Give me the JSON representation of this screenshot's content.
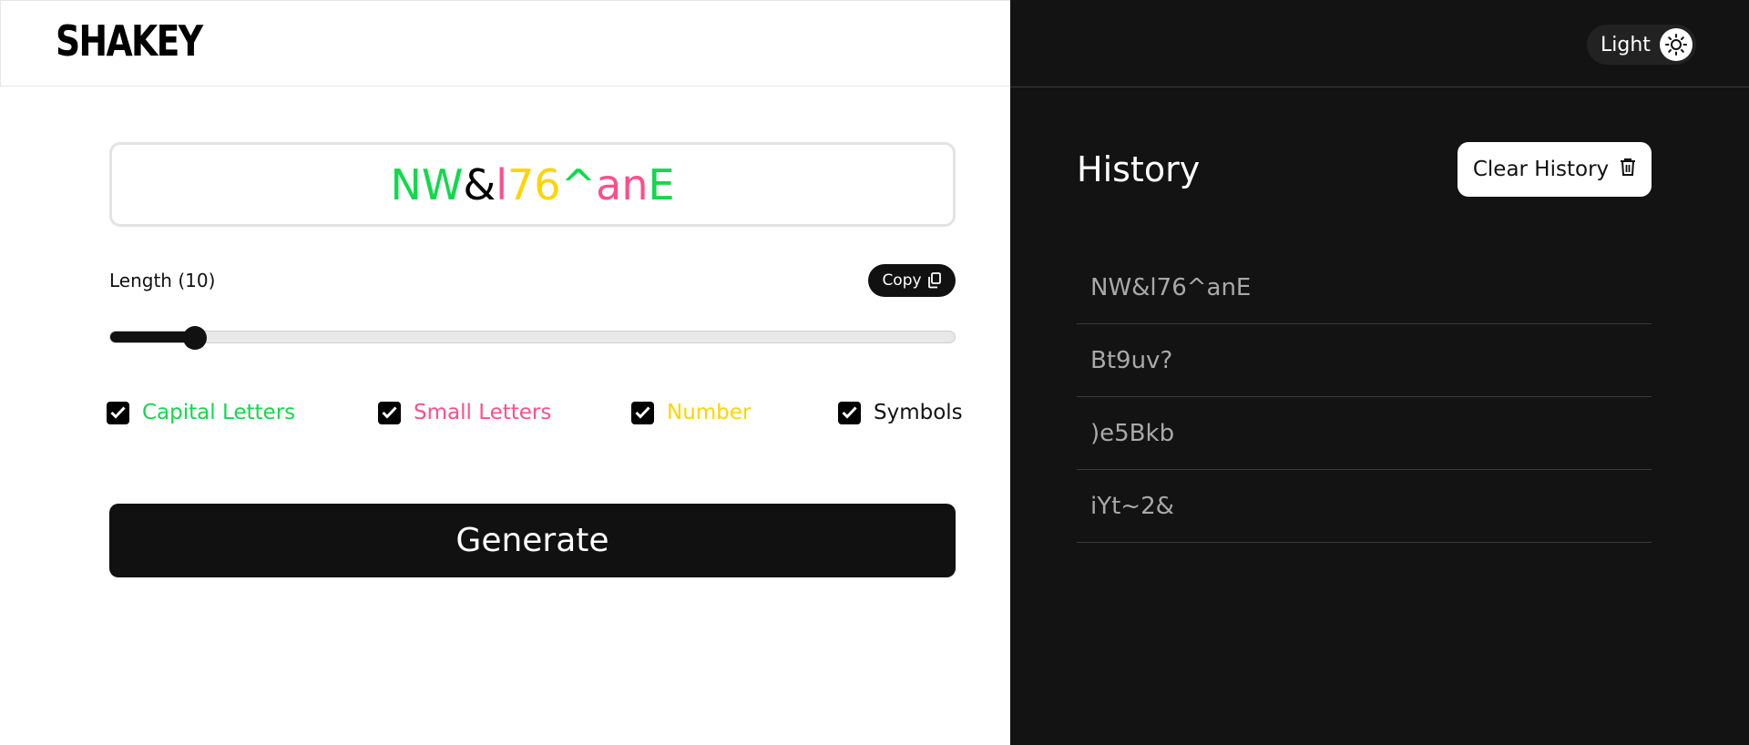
{
  "app": {
    "logo": "SHAKEY"
  },
  "generator": {
    "password_chars": [
      {
        "ch": "N",
        "color": "#11d94c"
      },
      {
        "ch": "W",
        "color": "#11d94c"
      },
      {
        "ch": "&",
        "color": "#000000"
      },
      {
        "ch": "l",
        "color": "#ff4f8b"
      },
      {
        "ch": "7",
        "color": "#ffd400"
      },
      {
        "ch": "6",
        "color": "#ffd400"
      },
      {
        "ch": "^",
        "color": "#11d94c"
      },
      {
        "ch": "a",
        "color": "#ff4f8b"
      },
      {
        "ch": "n",
        "color": "#ff4f8b"
      },
      {
        "ch": "E",
        "color": "#11d94c"
      }
    ],
    "length_label": "Length (10)",
    "length_value_fraction": 0.1,
    "copy_label": "Copy",
    "copy_icon": "copy-icon",
    "options": [
      {
        "label": "Capital Letters",
        "color": "#11d94c",
        "checked": true
      },
      {
        "label": "Small Letters",
        "color": "#ff4f8b",
        "checked": true
      },
      {
        "label": "Number",
        "color": "#ffd400",
        "checked": true
      },
      {
        "label": "Symbols",
        "color": "#111111",
        "checked": true
      }
    ],
    "generate_label": "Generate"
  },
  "theme": {
    "label": "Light",
    "icon": "sun-icon"
  },
  "history": {
    "title": "History",
    "clear_label": "Clear History",
    "clear_icon": "trash-icon",
    "items": [
      "NW&l76^anE",
      "Bt9uv?",
      ")e5Bkb",
      "iYt~2&"
    ]
  },
  "colors": {
    "dark_bg": "#131313",
    "capital": "#11d94c",
    "small": "#ff4f8b",
    "number": "#ffd400"
  }
}
